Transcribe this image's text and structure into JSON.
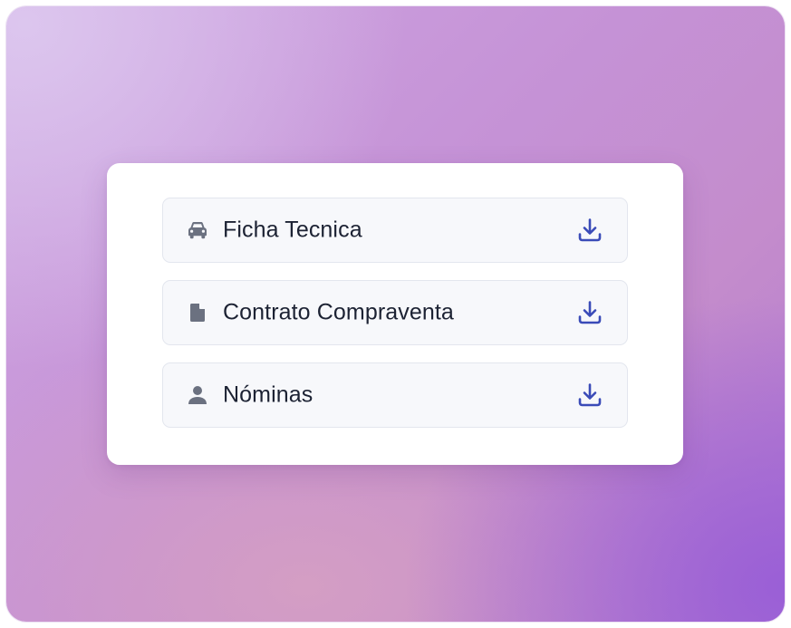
{
  "downloads": {
    "items": [
      {
        "label": "Ficha Tecnica",
        "icon": "car-icon"
      },
      {
        "label": "Contrato Compraventa",
        "icon": "document-icon"
      },
      {
        "label": "Nóminas",
        "icon": "user-icon"
      }
    ],
    "action_icon": "download-icon"
  },
  "colors": {
    "accent": "#3a4bb8",
    "icon_muted": "#6b7180",
    "text": "#1c2233",
    "row_bg": "#f7f8fb",
    "row_border": "#e3e6ee"
  }
}
